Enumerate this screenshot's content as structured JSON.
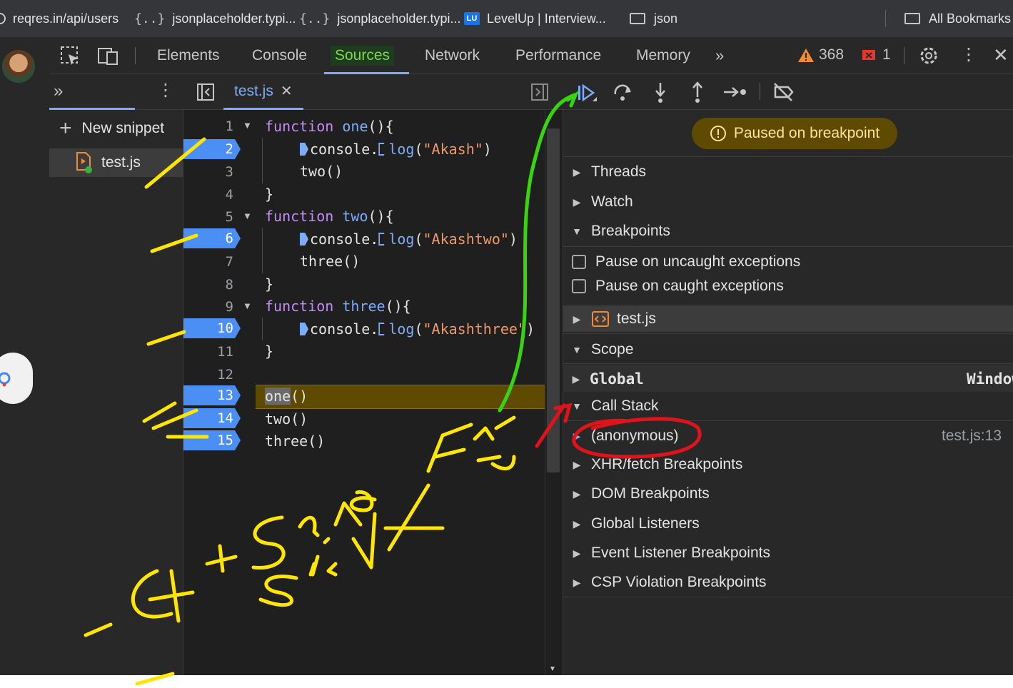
{
  "bookmarks": {
    "items": [
      {
        "label": "reqres.in/api/users"
      },
      {
        "label": "jsonplaceholder.typi..."
      },
      {
        "label": "jsonplaceholder.typi..."
      },
      {
        "label": "LevelUp | Interview...",
        "badge": "LU"
      },
      {
        "label": "json"
      }
    ],
    "all_bookmarks": "All Bookmarks"
  },
  "devtools": {
    "tabs": [
      "Elements",
      "Console",
      "Sources",
      "Network",
      "Performance",
      "Memory"
    ],
    "active_tab": "Sources",
    "warnings_count": "368",
    "errors_count": "1"
  },
  "navigator": {
    "new_snippet": "New snippet",
    "file": "test.js"
  },
  "editor": {
    "open_file": "test.js",
    "line_numbers": [
      "1",
      "2",
      "3",
      "4",
      "5",
      "6",
      "7",
      "8",
      "9",
      "10",
      "11",
      "12",
      "13",
      "14",
      "15"
    ],
    "code": {
      "kw_function": "function",
      "one": "one",
      "two": "two",
      "three": "three",
      "paren_open_brace": "(){",
      "console": "console.",
      "log": "log",
      "arg1_open": "(",
      "str_akash": "\"Akash\"",
      "str_akashtwo": "\"Akashtwo\"",
      "str_akashthree": "\"Akashthree\"",
      "arg_close": ")",
      "call_two": "two()",
      "call_three": "three()",
      "close_brace": "}",
      "call_parens": "()"
    }
  },
  "debugger": {
    "paused_message": "Paused on breakpoint",
    "sections": {
      "threads": "Threads",
      "watch": "Watch",
      "breakpoints": "Breakpoints",
      "pause_uncaught": "Pause on uncaught exceptions",
      "pause_caught": "Pause on caught exceptions",
      "bp_file": "test.js",
      "scope": "Scope",
      "global": "Global",
      "global_value": "Window",
      "call_stack": "Call Stack",
      "frame_name": "(anonymous)",
      "frame_location": "test.js:13",
      "xhr": "XHR/fetch Breakpoints",
      "dom": "DOM Breakpoints",
      "listeners": "Global Listeners",
      "event_listener": "Event Listener Breakpoints",
      "csp": "CSP Violation Breakpoints"
    }
  },
  "colors": {
    "accent_blue": "#7cacf8",
    "paused_bg": "#5e4a00",
    "active_tab_green": "#7cd74a",
    "annotation_yellow": "#ffe600",
    "annotation_green": "#39d40f",
    "annotation_red": "#e0121a"
  }
}
